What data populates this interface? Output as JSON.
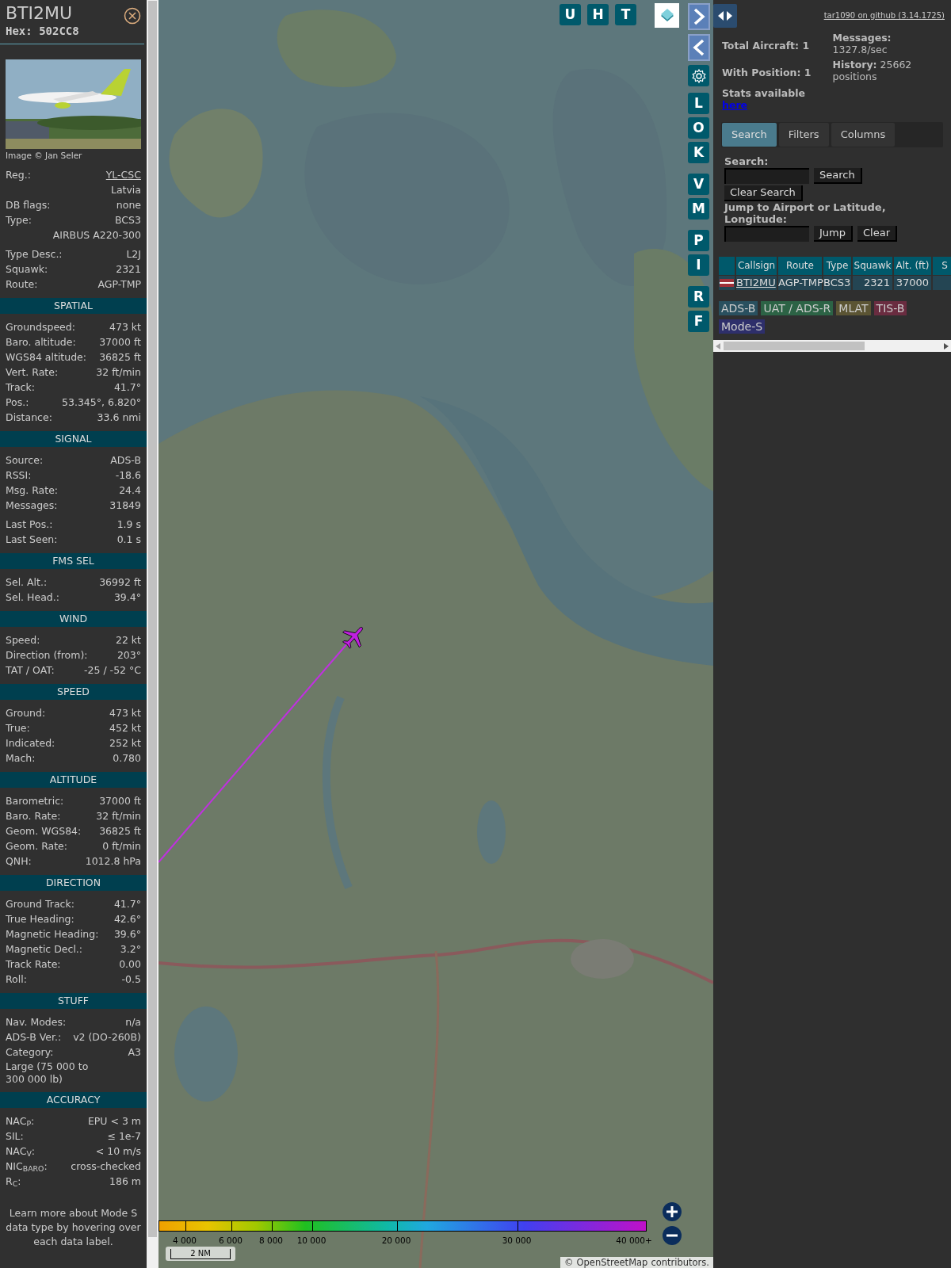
{
  "sidebar": {
    "callsign": "BTI2MU",
    "hex": "Hex: 502CC8",
    "photo_credit": "Image © Jan Seler",
    "info_groups": [
      [
        {
          "kind": "link",
          "label": "Reg.:",
          "value": "YL-CSC"
        },
        {
          "kind": "value",
          "value": "Latvia"
        },
        {
          "kind": "pair",
          "label": "DB flags:",
          "value": "none"
        },
        {
          "kind": "pair",
          "label": "Type:",
          "value": "BCS3"
        },
        {
          "kind": "value",
          "value": "AIRBUS A220-300"
        }
      ],
      [
        {
          "kind": "pair",
          "label": "Type Desc.:",
          "value": "L2J"
        },
        {
          "kind": "pair",
          "label": "Squawk:",
          "value": "2321"
        },
        {
          "kind": "pair",
          "label": "Route:",
          "value": "AGP-TMP"
        }
      ]
    ],
    "sections": [
      {
        "title": "SPATIAL",
        "groups": [
          [
            {
              "kind": "pair",
              "label": "Groundspeed:",
              "value": "473 kt"
            },
            {
              "kind": "pair",
              "label": "Baro. altitude:",
              "value": "37000 ft"
            },
            {
              "kind": "pair",
              "label": "WGS84 altitude:",
              "value": "36825 ft"
            },
            {
              "kind": "pair",
              "label": "Vert. Rate:",
              "value": "32 ft/min"
            },
            {
              "kind": "pair",
              "label": "Track:",
              "value": "41.7°"
            },
            {
              "kind": "pair",
              "label": "Pos.:",
              "value": "53.345°, 6.820°"
            },
            {
              "kind": "pair",
              "label": "Distance:",
              "value": "33.6 nmi"
            }
          ]
        ]
      },
      {
        "title": "SIGNAL",
        "groups": [
          [
            {
              "kind": "pair",
              "label": "Source:",
              "value": "ADS-B"
            },
            {
              "kind": "pair",
              "label": "RSSI:",
              "value": "-18.6"
            },
            {
              "kind": "pair",
              "label": "Msg. Rate:",
              "value": "24.4"
            },
            {
              "kind": "pair",
              "label": "Messages:",
              "value": "31849"
            }
          ],
          [
            {
              "kind": "pair",
              "label": "Last Pos.:",
              "value": "1.9 s"
            },
            {
              "kind": "pair",
              "label": "Last Seen:",
              "value": "0.1 s"
            }
          ]
        ]
      },
      {
        "title": "FMS SEL",
        "groups": [
          [
            {
              "kind": "pair",
              "label": "Sel. Alt.:",
              "value": "36992 ft"
            },
            {
              "kind": "pair",
              "label": "Sel. Head.:",
              "value": "39.4°"
            }
          ]
        ]
      },
      {
        "title": "WIND",
        "groups": [
          [
            {
              "kind": "pair",
              "label": "Speed:",
              "value": "22 kt"
            },
            {
              "kind": "pair",
              "label": "Direction (from):",
              "value": "203°"
            },
            {
              "kind": "pair",
              "label": "TAT / OAT:",
              "value": "-25 / -52 °C"
            }
          ]
        ]
      },
      {
        "title": "SPEED",
        "groups": [
          [
            {
              "kind": "pair",
              "label": "Ground:",
              "value": "473 kt"
            },
            {
              "kind": "pair",
              "label": "True:",
              "value": "452 kt"
            },
            {
              "kind": "pair",
              "label": "Indicated:",
              "value": "252 kt"
            },
            {
              "kind": "pair",
              "label": "Mach:",
              "value": "0.780"
            }
          ]
        ]
      },
      {
        "title": "ALTITUDE",
        "groups": [
          [
            {
              "kind": "pair",
              "label": "Barometric:",
              "value": "37000 ft"
            },
            {
              "kind": "pair",
              "label": "Baro. Rate:",
              "value": "32 ft/min"
            },
            {
              "kind": "pair",
              "label": "Geom. WGS84:",
              "value": "36825 ft"
            },
            {
              "kind": "pair",
              "label": "Geom. Rate:",
              "value": "0 ft/min"
            },
            {
              "kind": "pair",
              "label": "QNH:",
              "value": "1012.8 hPa"
            }
          ]
        ]
      },
      {
        "title": "DIRECTION",
        "groups": [
          [
            {
              "kind": "pair",
              "label": "Ground Track:",
              "value": "41.7°"
            },
            {
              "kind": "pair",
              "label": "True Heading:",
              "value": "42.6°"
            },
            {
              "kind": "pair",
              "label": "Magnetic Heading:",
              "value": "39.6°"
            },
            {
              "kind": "pair",
              "label": "Magnetic Decl.:",
              "value": "3.2°"
            },
            {
              "kind": "pair",
              "label": "Track Rate:",
              "value": "0.00"
            },
            {
              "kind": "pair",
              "label": "Roll:",
              "value": "-0.5"
            }
          ]
        ]
      },
      {
        "title": "STUFF",
        "groups": [
          [
            {
              "kind": "pair",
              "label": "Nav. Modes:",
              "value": "n/a"
            },
            {
              "kind": "pair",
              "label": "ADS-B Ver.:",
              "value": "v2 (DO-260B)"
            },
            {
              "kind": "pair",
              "label": "Category:",
              "value": "A3"
            },
            {
              "kind": "text",
              "value": "Large (75 000 to 300 000 lb)"
            }
          ]
        ]
      },
      {
        "title": "ACCURACY",
        "groups": [
          [
            {
              "kind": "pair",
              "label": "NAC$_{P}$:",
              "value": "EPU < 3 m"
            },
            {
              "kind": "pair",
              "label": "SIL:",
              "value": "≤ 1e-7"
            },
            {
              "kind": "pair",
              "label": "NAC$_{V}$:",
              "value": "< 10 m/s"
            },
            {
              "kind": "pair",
              "label": "NIC$_{BARO}$:",
              "value": "cross-checked"
            },
            {
              "kind": "pair",
              "label": "R$_{C}$:",
              "value": "186 m"
            }
          ]
        ]
      }
    ],
    "note": "Learn more about Mode S data type by hovering over each data label."
  },
  "map": {
    "top_buttons": [
      "U",
      "H",
      "T"
    ],
    "letter_groups": [
      [
        "L",
        "O",
        "K"
      ],
      [
        "V",
        "M"
      ],
      [
        "P",
        "I"
      ],
      [
        "R",
        "F"
      ]
    ],
    "altitude_legend": [
      "4 000",
      "6 000",
      "8 000",
      "10 000",
      "20 000",
      "30 000",
      "40 000+"
    ],
    "scale": "2 NM",
    "attribution": {
      "prefix": "©",
      "link": "OpenStreetMap",
      "suffix": "contributors."
    }
  },
  "panel": {
    "version_link": "tar1090 on github (3.14.1725)",
    "stats_left": [
      "Total Aircraft: 1",
      "With Position: 1"
    ],
    "stats_text": "Stats available",
    "stats_link": "here",
    "stats_right": [
      "**Messages:** 1327.8/sec",
      "**History:** 25662 positions"
    ],
    "tabs": [
      {
        "label": "Search",
        "selected": true
      },
      {
        "label": "Filters",
        "selected": false
      },
      {
        "label": "Columns",
        "selected": false
      }
    ],
    "search": {
      "label": "Search:",
      "search_button": "Search",
      "clear_button": "Clear Search",
      "jump_label": "Jump to Airport or Latitude, Longitude:",
      "jump_button": "Jump",
      "jump_clear_button": "Clear"
    },
    "table": {
      "columns": [
        "Callsign",
        "Route",
        "Type",
        "Squawk",
        "Alt. (ft)",
        "S"
      ],
      "rows": [
        {
          "cells": [
            "BTI2MU",
            "AGP-TMP",
            "BCS3",
            "2321",
            "37000"
          ]
        }
      ]
    },
    "source_legend": [
      {
        "label": "ADS-B",
        "color": "#29505f"
      },
      {
        "label": "UAT / ADS-R",
        "color": "#2c6345"
      },
      {
        "label": "MLAT",
        "color": "#5b5433"
      },
      {
        "label": "TIS-B",
        "color": "#6a2c40"
      },
      {
        "label": "Mode-S",
        "color": "#2e2f6b"
      }
    ]
  }
}
